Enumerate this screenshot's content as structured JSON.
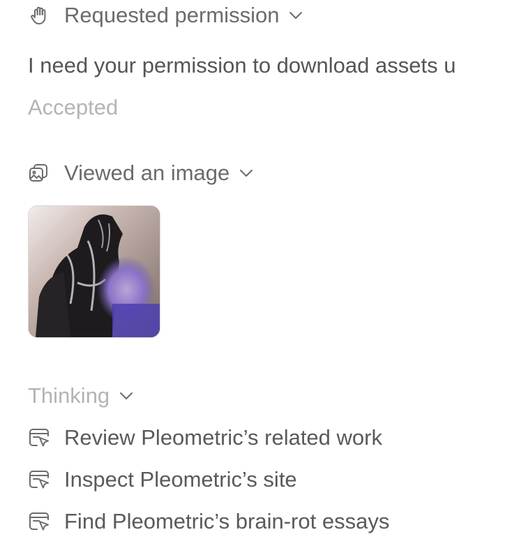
{
  "permission": {
    "title": "Requested permission",
    "icon": "hand-icon",
    "message": "I need your permission to download assets u",
    "status": "Accepted"
  },
  "image_step": {
    "title": "Viewed an image",
    "icon": "image-icon"
  },
  "thinking": {
    "title": "Thinking",
    "tasks": [
      {
        "label": "Review Pleometric’s related work",
        "icon": "browser-cursor-icon"
      },
      {
        "label": "Inspect Pleometric’s site",
        "icon": "browser-cursor-icon"
      },
      {
        "label": "Find Pleometric’s brain-rot essays",
        "icon": "browser-cursor-icon"
      }
    ]
  },
  "colors": {
    "text": "#5f5f5f",
    "muted": "#b4b4b4",
    "background": "#ffffff"
  }
}
